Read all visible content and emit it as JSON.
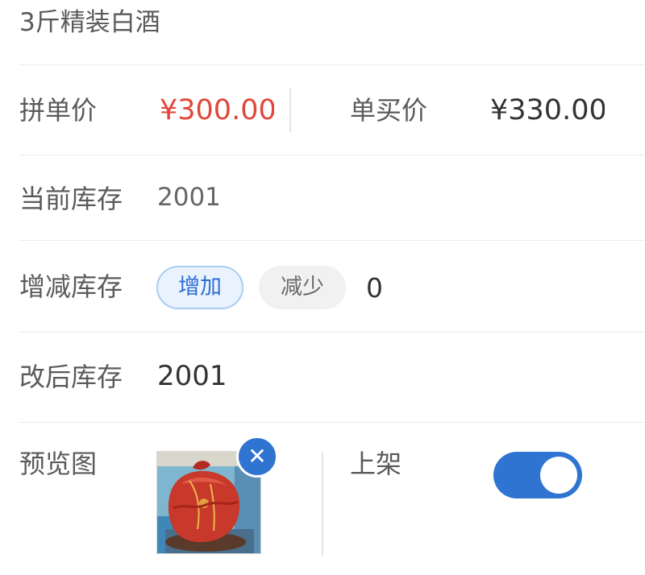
{
  "product": {
    "name": "3斤精装白酒"
  },
  "prices": {
    "group_label": "拼单价",
    "group_value": "¥300.00",
    "single_label": "单买价",
    "single_value": "¥330.00"
  },
  "stock": {
    "current_label": "当前库存",
    "current_value": "2001",
    "adjust_label": "增减库存",
    "increase_label": "增加",
    "decrease_label": "减少",
    "adjust_value": "0",
    "after_label": "改后库存",
    "after_value": "2001"
  },
  "preview": {
    "label": "预览图",
    "delete_glyph": "✕",
    "image_icon": "product-photo-red-wrapped-jar"
  },
  "listing": {
    "label": "上架",
    "on": true
  },
  "colors": {
    "accent": "#2f74d0",
    "price_red": "#e2463a"
  }
}
